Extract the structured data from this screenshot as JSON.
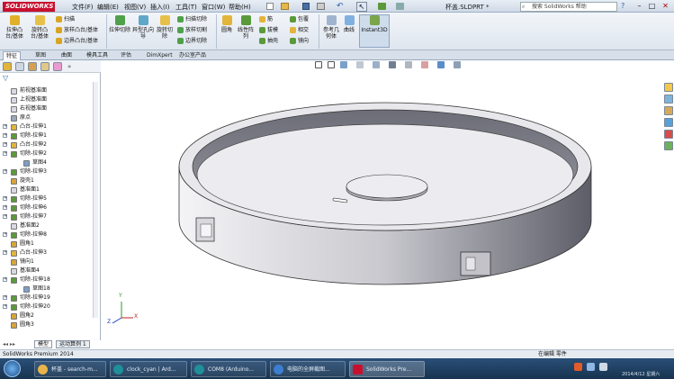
{
  "app": {
    "logo": "SOLIDWORKS",
    "document_title": "杯盖.SLDPRT *",
    "search_placeholder": "搜索 SolidWorks 帮助"
  },
  "menu": [
    "文件(F)",
    "编辑(E)",
    "视图(V)",
    "插入(I)",
    "工具(T)",
    "窗口(W)",
    "帮助(H)"
  ],
  "ribbon": {
    "extrude_boss": "拉伸凸台/基体",
    "revolve_boss": "旋转凸台/基体",
    "sweep": "扫描",
    "loft": "放样凸台/基体",
    "boundary_boss": "边界凸台/基体",
    "extrude_cut": "拉伸切除",
    "hole_wizard": "异型孔向导",
    "revolve_cut": "旋转切除",
    "swept_cut": "扫描切除",
    "lofted_cut": "放样切割",
    "boundary_cut": "边界切除",
    "fillet": "圆角",
    "linear_pattern": "线性阵列",
    "rib": "筋",
    "draft": "拔模",
    "shell": "抽壳",
    "wrap": "包覆",
    "intersect": "相交",
    "mirror": "镜向",
    "ref_geometry": "参考几何体",
    "curves": "曲线",
    "instant3d": "Instant3D"
  },
  "tabs": [
    "特征",
    "草图",
    "曲面",
    "模具工具",
    "评估",
    "DimXpert",
    "办公室产品"
  ],
  "tree": [
    {
      "label": "前视基准面",
      "type": "plane"
    },
    {
      "label": "上视基准面",
      "type": "plane"
    },
    {
      "label": "右视基准面",
      "type": "plane"
    },
    {
      "label": "原点",
      "type": "origin"
    },
    {
      "label": "凸台-拉伸1",
      "type": "boss"
    },
    {
      "label": "切除-拉伸1",
      "type": "cut"
    },
    {
      "label": "凸台-拉伸2",
      "type": "boss"
    },
    {
      "label": "切除-拉伸2",
      "type": "cut"
    },
    {
      "label": "草图4",
      "type": "sketch"
    },
    {
      "label": "切除-拉伸3",
      "type": "cut"
    },
    {
      "label": "旋壳1",
      "type": "feature"
    },
    {
      "label": "基准面1",
      "type": "plane"
    },
    {
      "label": "切除-拉伸5",
      "type": "cut"
    },
    {
      "label": "切除-拉伸6",
      "type": "cut"
    },
    {
      "label": "切除-拉伸7",
      "type": "cut"
    },
    {
      "label": "基准面2",
      "type": "plane"
    },
    {
      "label": "切除-拉伸8",
      "type": "cut"
    },
    {
      "label": "圆角1",
      "type": "feature"
    },
    {
      "label": "凸台-拉伸3",
      "type": "boss"
    },
    {
      "label": "镜向1",
      "type": "feature"
    },
    {
      "label": "基准面4",
      "type": "plane"
    },
    {
      "label": "切除-拉伸18",
      "type": "cut"
    },
    {
      "label": "草图18",
      "type": "sketch"
    },
    {
      "label": "切除-拉伸19",
      "type": "cut"
    },
    {
      "label": "切除-拉伸20",
      "type": "cut"
    },
    {
      "label": "圆角2",
      "type": "feature"
    },
    {
      "label": "圆角3",
      "type": "feature"
    }
  ],
  "bottom_tabs": [
    "模型",
    "运动算例 1"
  ],
  "status": {
    "left": "SolidWorks Premium 2014",
    "right": "在编辑 零件"
  },
  "taskbar": [
    {
      "label": "杯盖 - search-m..."
    },
    {
      "label": "clock_cyan | Ard..."
    },
    {
      "label": "COM8 (Arduino..."
    },
    {
      "label": "电脑的全屏截图..."
    },
    {
      "label": "SolidWorks Pre..."
    }
  ],
  "tray": {
    "time": "2014/4/12 星期六"
  },
  "colors": {
    "accent": "#c8102e",
    "ribbon_bg": "#e4eaf2",
    "taskbar": "#1f3f62",
    "model_fill": "#e6e6ea",
    "model_dark": "#5f5f6a"
  }
}
